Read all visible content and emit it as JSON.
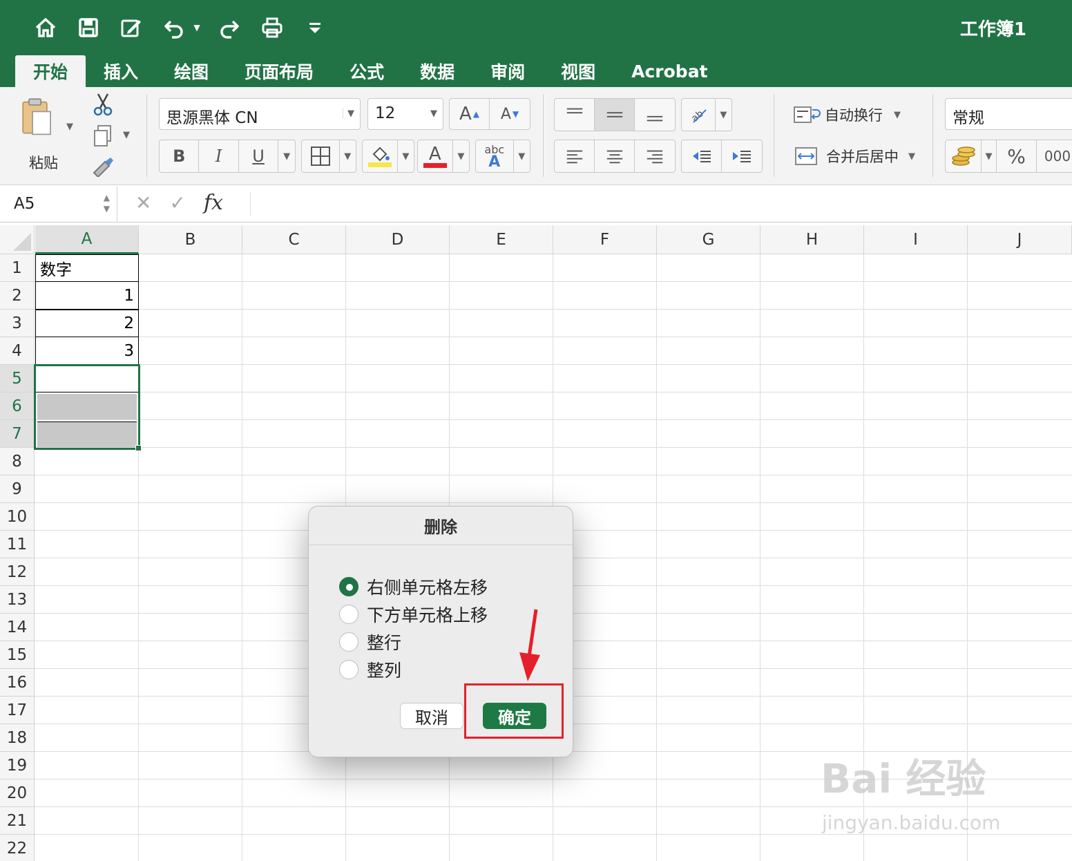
{
  "window": {
    "title": "工作簿1"
  },
  "tabs": [
    "开始",
    "插入",
    "绘图",
    "页面布局",
    "公式",
    "数据",
    "审阅",
    "视图",
    "Acrobat"
  ],
  "ribbon": {
    "paste_label": "粘贴",
    "font_name": "思源黑体 CN",
    "font_size": "12",
    "bold": "B",
    "italic": "I",
    "underline": "U",
    "grow_font": "A",
    "shrink_font": "A",
    "font_color_letter": "A",
    "abc": "abc",
    "abc_a": "A",
    "wrap_text": "自动换行",
    "merge_center": "合并后居中",
    "number_format": "常规",
    "percent": "%",
    "thousands": "000",
    "font_color_hex": "#e5202a",
    "fill_color_hex": "#f5e84a"
  },
  "formula_bar": {
    "name_box": "A5",
    "fx": "fx",
    "cancel": "✕",
    "enter": "✓"
  },
  "sheet": {
    "columns": [
      "A",
      "B",
      "C",
      "D",
      "E",
      "F",
      "G",
      "H",
      "I",
      "J"
    ],
    "rows": [
      "1",
      "2",
      "3",
      "4",
      "5",
      "6",
      "7",
      "8",
      "9",
      "10",
      "11",
      "12",
      "13",
      "14",
      "15",
      "16",
      "17",
      "18",
      "19",
      "20",
      "21",
      "22"
    ],
    "cells": {
      "A1": "数字",
      "A2": "1",
      "A3": "2",
      "A4": "3"
    }
  },
  "dialog": {
    "title": "删除",
    "options": [
      "右侧单元格左移",
      "下方单元格上移",
      "整行",
      "整列"
    ],
    "selected_index": 0,
    "cancel": "取消",
    "ok": "确定"
  },
  "watermark": {
    "brand": "Bai 经验",
    "url": "jingyan.baidu.com"
  },
  "colors": {
    "accent": "#217346",
    "highlight": "#e5202a"
  }
}
